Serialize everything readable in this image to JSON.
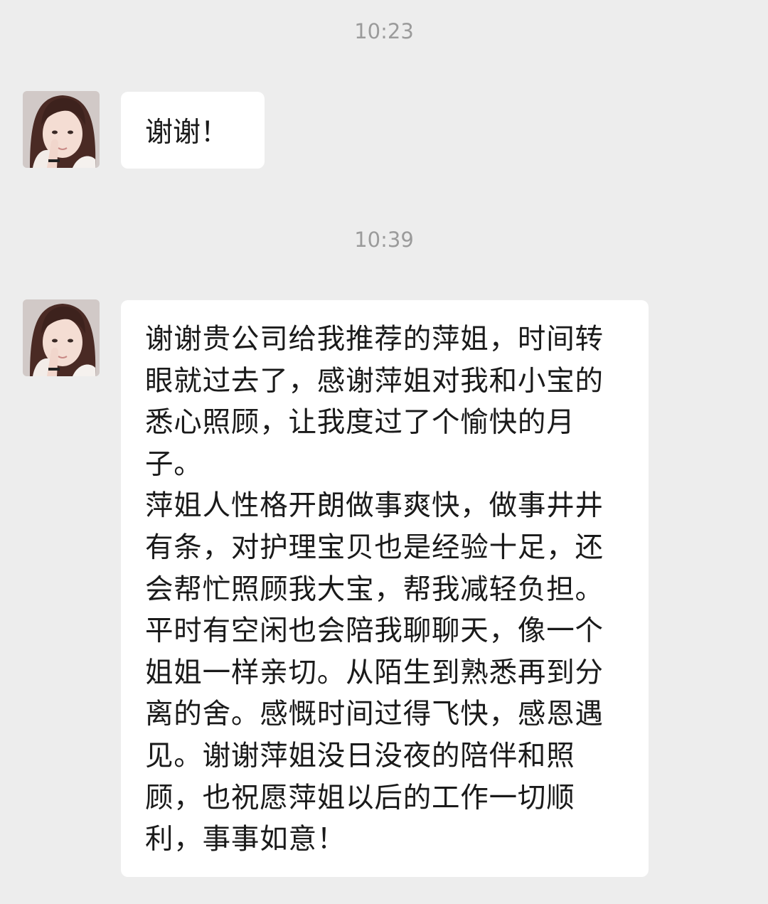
{
  "chat": {
    "messages": [
      {
        "time": "10:23",
        "sender": "contact",
        "avatar_icon": "girl-avatar",
        "text": "谢谢！"
      },
      {
        "time": "10:39",
        "sender": "contact",
        "avatar_icon": "girl-avatar",
        "paragraphs": [
          "谢谢贵公司给我推荐的萍姐，时间转眼就过去了，感谢萍姐对我和小宝的悉心照顾，让我度过了个愉快的月子。",
          "萍姐人性格开朗做事爽快，做事井井有条，对护理宝贝也是经验十足，还会帮忙照顾我大宝，帮我减轻负担。平时有空闲也会陪我聊聊天，像一个姐姐一样亲切。从陌生到熟悉再到分离的舍。感慨时间过得飞快，感恩遇见。谢谢萍姐没日没夜的陪伴和照顾，也祝愿萍姐以后的工作一切顺利，事事如意！"
        ]
      }
    ]
  },
  "colors": {
    "background": "#ededed",
    "bubble": "#ffffff",
    "timestamp": "#9b9b9b",
    "text": "#1a1a1a"
  }
}
